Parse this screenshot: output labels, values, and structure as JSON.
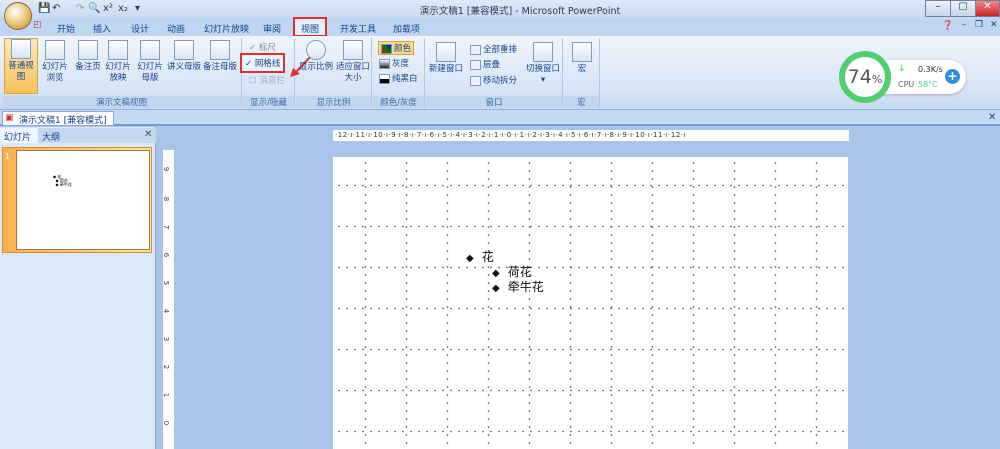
{
  "window": {
    "title": "演示文稿1 [兼容模式] - Microsoft PowerPoint"
  },
  "qat": {
    "save": "💾",
    "undo": "↶",
    "redo": "↷",
    "preview": "🔍",
    "superscript": "x²",
    "subscript": "x₂",
    "more": "▾"
  },
  "tabs": [
    "开始",
    "插入",
    "设计",
    "动画",
    "幻灯片放映",
    "审阅",
    "视图",
    "开发工具",
    "加载项"
  ],
  "active_tab": "视图",
  "ribbon": {
    "views": {
      "label": "演示文稿视图",
      "buttons": [
        "普通视图",
        "幻灯片浏览",
        "备注页",
        "幻灯片放映",
        "幻灯片母版",
        "讲义母版",
        "备注母版"
      ]
    },
    "show_hide": {
      "label": "显示/隐藏",
      "ruler": "标尺",
      "gridlines": "网格线",
      "message_bar": "消息栏",
      "gridlines_checked": true,
      "ruler_checked": true
    },
    "zoom": {
      "label": "显示比例",
      "buttons": [
        "显示比例",
        "适应窗口大小"
      ]
    },
    "color": {
      "label": "颜色/灰度",
      "items": [
        "颜色",
        "灰度",
        "纯黑白"
      ]
    },
    "window": {
      "label": "窗口",
      "new_window": "新建窗口",
      "arrange_all": "全部重排",
      "cascade": "层叠",
      "move_split": "移动拆分",
      "switch": "切换窗口"
    },
    "macros": {
      "label": "宏",
      "button": "宏"
    }
  },
  "widget": {
    "percent": "74",
    "percent_sign": "%",
    "net": "0.3K/s",
    "cpu_label": "CPU",
    "cpu_temp": "58°C",
    "accent": "#4fd070"
  },
  "document_tab": "演示文稿1 [兼容模式]",
  "pane": {
    "tabs": [
      "幻灯片",
      "大纲"
    ],
    "slide_number": "1"
  },
  "ruler": {
    "horizontal": "·12·ı·11·ı·10·ı·9·ı·8·ı·7·ı·6·ı·5·ı·4·ı·3·ı·2·ı·1·ı·0·ı·1·ı·2·ı·3·ı·4·ı·5·ı·6·ı·7·ı·8·ı·9·ı·10·ı·11·ı·12·ı",
    "vertical": [
      "9",
      "8",
      "7",
      "6",
      "5",
      "4",
      "3",
      "2",
      "1",
      "0"
    ]
  },
  "slide": {
    "bullets": [
      {
        "text": "花",
        "level": 1
      },
      {
        "text": "荷花",
        "level": 2
      },
      {
        "text": "牵牛花",
        "level": 2
      }
    ]
  }
}
